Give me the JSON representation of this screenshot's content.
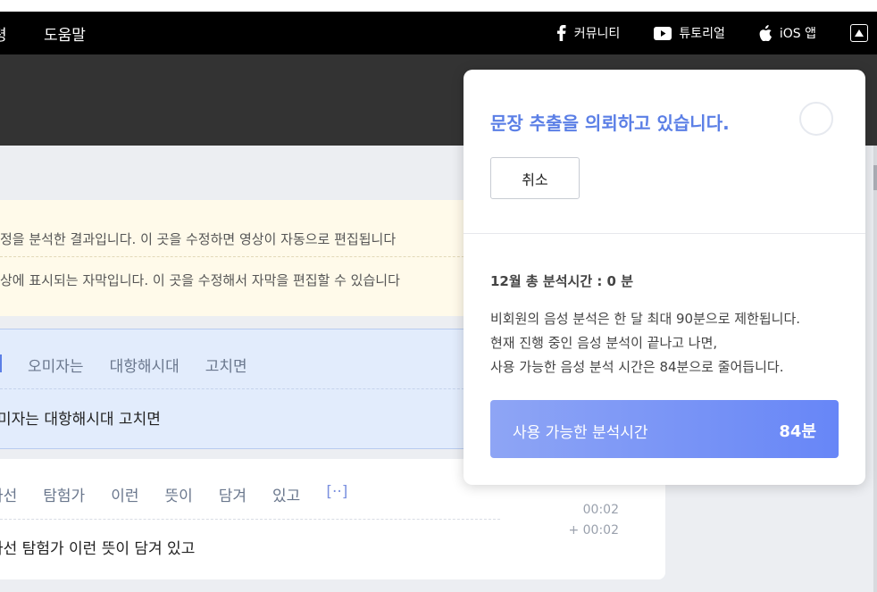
{
  "nav": {
    "left_cut": "령",
    "help": "도움말",
    "community": "커뮤니티",
    "tutorial": "튜토리얼",
    "ios": "iOS 앱"
  },
  "notice": {
    "line1": "정을 분석한 결과입니다. 이 곳을 수정하면 영상이 자동으로 편집됩니다",
    "line2": "상에 표시되는 자막입니다. 이 곳을 수정해서 자막을 편집할 수 있습니다"
  },
  "segment1": {
    "words": [
      "오미자는",
      "대항해시대",
      "고치면"
    ],
    "text": "미자는 대항해시대 고치면"
  },
  "segment2": {
    "words": [
      "사선",
      "탐험가",
      "이런",
      "뜻이",
      "담겨",
      "있고",
      "[··]"
    ],
    "text": "사선 탐험가 이런 뜻이 담겨 있고",
    "start": "00:02",
    "end": "+ 00:02"
  },
  "popup": {
    "title": "문장 추출을 의뢰하고 있습니다.",
    "cancel": "취소",
    "usage_label": "12월 총 분석시간 : 0 분",
    "info": [
      "비회원의 음성 분석은 한 달 최대 90분으로 제한됩니다.",
      "현재 진행 중인 음성 분석이 끝나고 나면,",
      "사용 가능한 음성 분석 시간은 84분으로 줄어듭니다."
    ],
    "available_label": "사용 가능한 분석시간",
    "available_value": "84분"
  }
}
